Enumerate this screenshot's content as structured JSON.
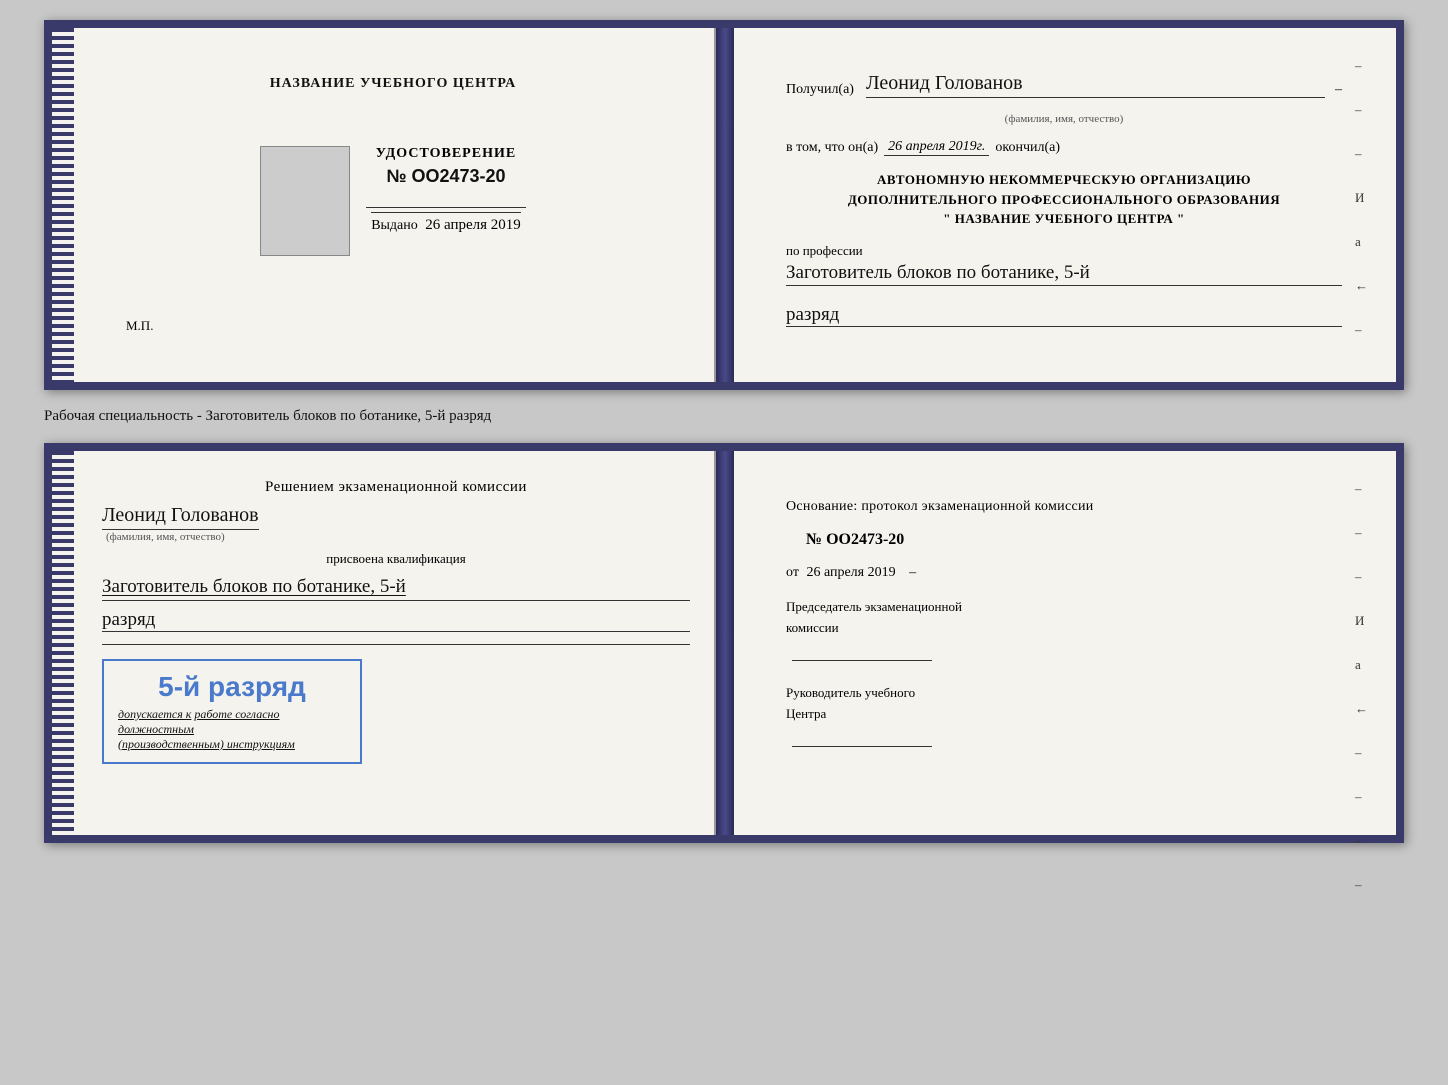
{
  "top_cert": {
    "left": {
      "center_title": "НАЗВАНИЕ УЧЕБНОГО ЦЕНТРА",
      "cert_label": "УДОСТОВЕРЕНИЕ",
      "cert_number": "№ OO2473-20",
      "issued_prefix": "Выдано",
      "issued_date": "26 апреля 2019",
      "mp_label": "М.П."
    },
    "right": {
      "received_prefix": "Получил(а)",
      "recipient_name": "Леонид Голованов",
      "name_subtitle": "(фамилия, имя, отчество)",
      "in_that_prefix": "в том, что он(а)",
      "date_value": "26 апреля 2019г.",
      "finished_suffix": "окончил(а)",
      "org_line1": "АВТОНОМНУЮ НЕКОММЕРЧЕСКУЮ ОРГАНИЗАЦИЮ",
      "org_line2": "ДОПОЛНИТЕЛЬНОГО ПРОФЕССИОНАЛЬНОГО ОБРАЗОВАНИЯ",
      "org_line3": "\"   НАЗВАНИЕ УЧЕБНОГО ЦЕНТРА   \"",
      "profession_prefix": "по профессии",
      "profession_value": "Заготовитель блоков по ботанике, 5-й",
      "razryad_value": "разряд"
    }
  },
  "specialty_label": "Рабочая специальность - Заготовитель блоков по ботанике, 5-й разряд",
  "bottom_cert": {
    "left": {
      "decision_text": "Решением экзаменационной комиссии",
      "person_name": "Леонид Голованов",
      "name_subtitle": "(фамилия, имя, отчество)",
      "assigned_text": "присвоена квалификация",
      "qual_value": "Заготовитель блоков по ботанике, 5-й",
      "razryad_value": "разряд",
      "admitted_prefix": "допускается к",
      "admitted_italic": "работе согласно должностным",
      "admitted_italic2": "(производственным) инструкциям",
      "stamp_rank": "5-й разряд"
    },
    "right": {
      "foundation_text": "Основание: протокол экзаменационной комиссии",
      "protocol_number": "№  OO2473-20",
      "from_prefix": "от",
      "from_date": "26 апреля 2019",
      "chairman_title": "Председатель экзаменационной",
      "chairman_title2": "комиссии",
      "leader_title": "Руководитель учебного",
      "leader_title2": "Центра"
    }
  },
  "dashes": [
    "-",
    "-",
    "-",
    "И",
    "а",
    "←",
    "-",
    "-",
    "-",
    "-"
  ],
  "dashes_bottom": [
    "-",
    "-",
    "-",
    "И",
    "а",
    "←",
    "-",
    "-",
    "-",
    "-"
  ]
}
